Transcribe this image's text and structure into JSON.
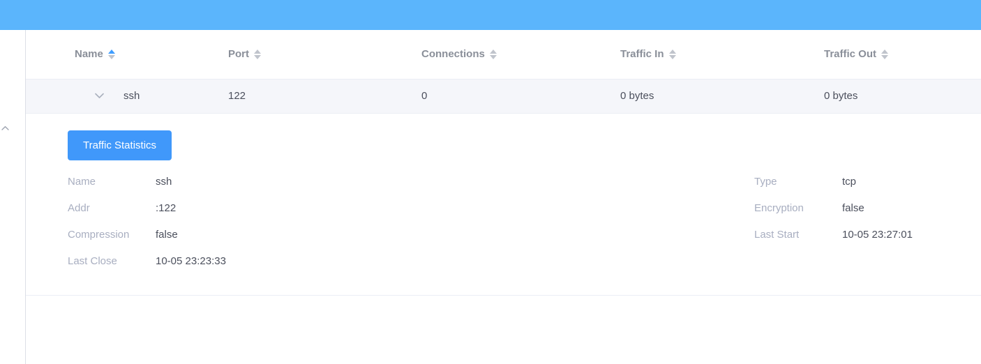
{
  "theme": {
    "topbar_color": "#5bb5fc",
    "button_color": "#4098fa",
    "row_highlight": "#f5f6fa",
    "border_color": "#ebeef5",
    "label_color": "#a8aec0",
    "value_color": "#4b4f5c",
    "header_text_color": "#8a8f99",
    "sort_active_color": "#409eff",
    "sort_inactive_color": "#c0c4cc"
  },
  "table": {
    "columns": [
      {
        "key": "name",
        "label": "Name",
        "sort": "asc",
        "icon": "sort-icon"
      },
      {
        "key": "port",
        "label": "Port",
        "sort": "none",
        "icon": "sort-icon"
      },
      {
        "key": "connections",
        "label": "Connections",
        "sort": "none",
        "icon": "sort-icon"
      },
      {
        "key": "traffic_in",
        "label": "Traffic In",
        "sort": "none",
        "icon": "sort-icon"
      },
      {
        "key": "traffic_out",
        "label": "Traffic Out",
        "sort": "none",
        "icon": "sort-icon"
      }
    ],
    "rows": [
      {
        "expand_icon": "chevron-down-icon",
        "expanded": true,
        "name": "ssh",
        "port": "122",
        "connections": "0",
        "traffic_in": "0 bytes",
        "traffic_out": "0 bytes"
      }
    ]
  },
  "detail": {
    "traffic_button_label": "Traffic Statistics",
    "left_fields": [
      {
        "label": "Name",
        "value": "ssh"
      },
      {
        "label": "Addr",
        "value": ":122"
      },
      {
        "label": "Compression",
        "value": "false"
      },
      {
        "label": "Last Close",
        "value": "10-05 23:23:33"
      }
    ],
    "right_fields": [
      {
        "label": "Type",
        "value": "tcp"
      },
      {
        "label": "Encryption",
        "value": "false"
      },
      {
        "label": "Last Start",
        "value": "10-05 23:27:01"
      }
    ]
  },
  "sidebar": {
    "collapse_icon": "chevron-up-icon"
  }
}
